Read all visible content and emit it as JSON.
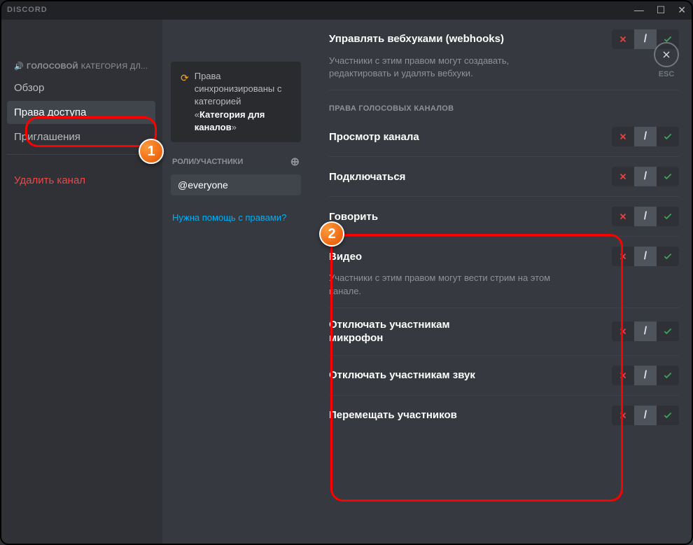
{
  "app_name": "DISCORD",
  "sidebar": {
    "header_prefix": "ГОЛОСОВОЙ",
    "header_suffix": "КАТЕГОРИЯ ДЛ...",
    "items": {
      "overview": "Обзор",
      "permissions": "Права доступа",
      "invites": "Приглашения",
      "delete": "Удалить канал"
    }
  },
  "middle": {
    "sync_text_1": "Права синхронизированы с категорией «",
    "sync_text_2": "Категория для каналов",
    "sync_text_3": "»",
    "roles_header": "РОЛИ/УЧАСТНИКИ",
    "role_everyone": "@everyone",
    "help_link": "Нужна помощь с правами?"
  },
  "close_label": "ESC",
  "permissions": {
    "webhooks": {
      "title": "Управлять вебхуками (webhooks)",
      "desc": "Участники с этим правом могут создавать, редактировать и удалять вебхуки."
    },
    "section_voice": "ПРАВА ГОЛОСОВЫХ КАНАЛОВ",
    "view": {
      "title": "Просмотр канала"
    },
    "connect": {
      "title": "Подключаться"
    },
    "speak": {
      "title": "Говорить"
    },
    "video": {
      "title": "Видео",
      "desc": "Участники с этим правом могут вести стрим на этом канале."
    },
    "mute": {
      "title": "Отключать участникам микрофон"
    },
    "deafen": {
      "title": "Отключать участникам звук"
    },
    "move": {
      "title": "Перемещать участников"
    }
  },
  "toggle": {
    "slash": "/"
  }
}
